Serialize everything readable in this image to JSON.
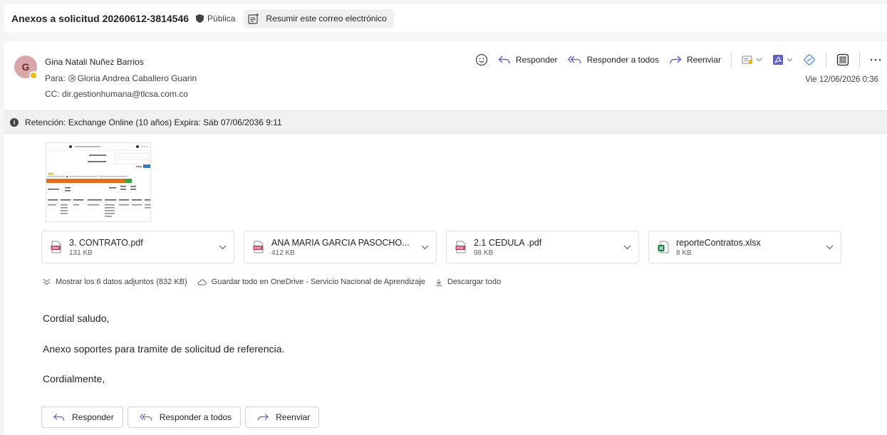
{
  "header": {
    "subject": "Anexos a solicitud 20260612-3814546",
    "sensitivity": "Pública",
    "summarize_label": "Resumir este correo electrónico"
  },
  "message": {
    "avatar_initial": "G",
    "from": "Gina Natali Nuñez Barrios",
    "to_label": "Para:",
    "to": "Gloria Andrea Caballero Guarin",
    "cc_label": "CC:",
    "cc": "dir.gestionhumana@tlcsa.com.co",
    "date": "Vie 12/06/2026 0:36",
    "actions": {
      "reply": "Responder",
      "reply_all": "Responder a todos",
      "forward": "Reenviar"
    },
    "retention": "Retención: Exchange Online (10 años) Expira: Sáb 07/06/2036 9:11"
  },
  "attachments": [
    {
      "name": "3. CONTRATO.pdf",
      "size": "131 KB",
      "type": "pdf"
    },
    {
      "name": "ANA MARIA GARCIA PASOCHO...",
      "size": "412 KB",
      "type": "pdf"
    },
    {
      "name": "2.1 CEDULA .pdf",
      "size": "98 KB",
      "type": "pdf"
    },
    {
      "name": "reporteContratos.xlsx",
      "size": "8 KB",
      "type": "xlsx"
    }
  ],
  "attachment_links": {
    "show_all": "Mostrar los 6 datos adjuntos (832 KB)",
    "save_onedrive": "Guardar todo en OneDrive - Servicio Nacional de Aprendizaje",
    "download_all": "Descargar todo"
  },
  "body": {
    "greeting": "Cordial saludo,",
    "line1": "Anexo soportes para tramite de solicitud de referencia.",
    "closing": "Cordialmente,"
  },
  "reply_buttons": {
    "reply": "Responder",
    "reply_all": "Responder a todos",
    "forward": "Reenviar"
  },
  "colors": {
    "accent": "#0f6cbd",
    "pdf_red": "#c4314b",
    "excel_green": "#107c41",
    "presence_away": "#f2b81d"
  },
  "icons": [
    "shield-icon",
    "summarize-icon",
    "emoji-icon",
    "reply-icon",
    "reply-all-icon",
    "forward-icon",
    "teams-icon",
    "pdf-icon",
    "loop-icon",
    "apps-icon",
    "more-icon",
    "info-icon",
    "chevron-down-icon",
    "excel-icon",
    "cloud-icon",
    "download-icon"
  ]
}
